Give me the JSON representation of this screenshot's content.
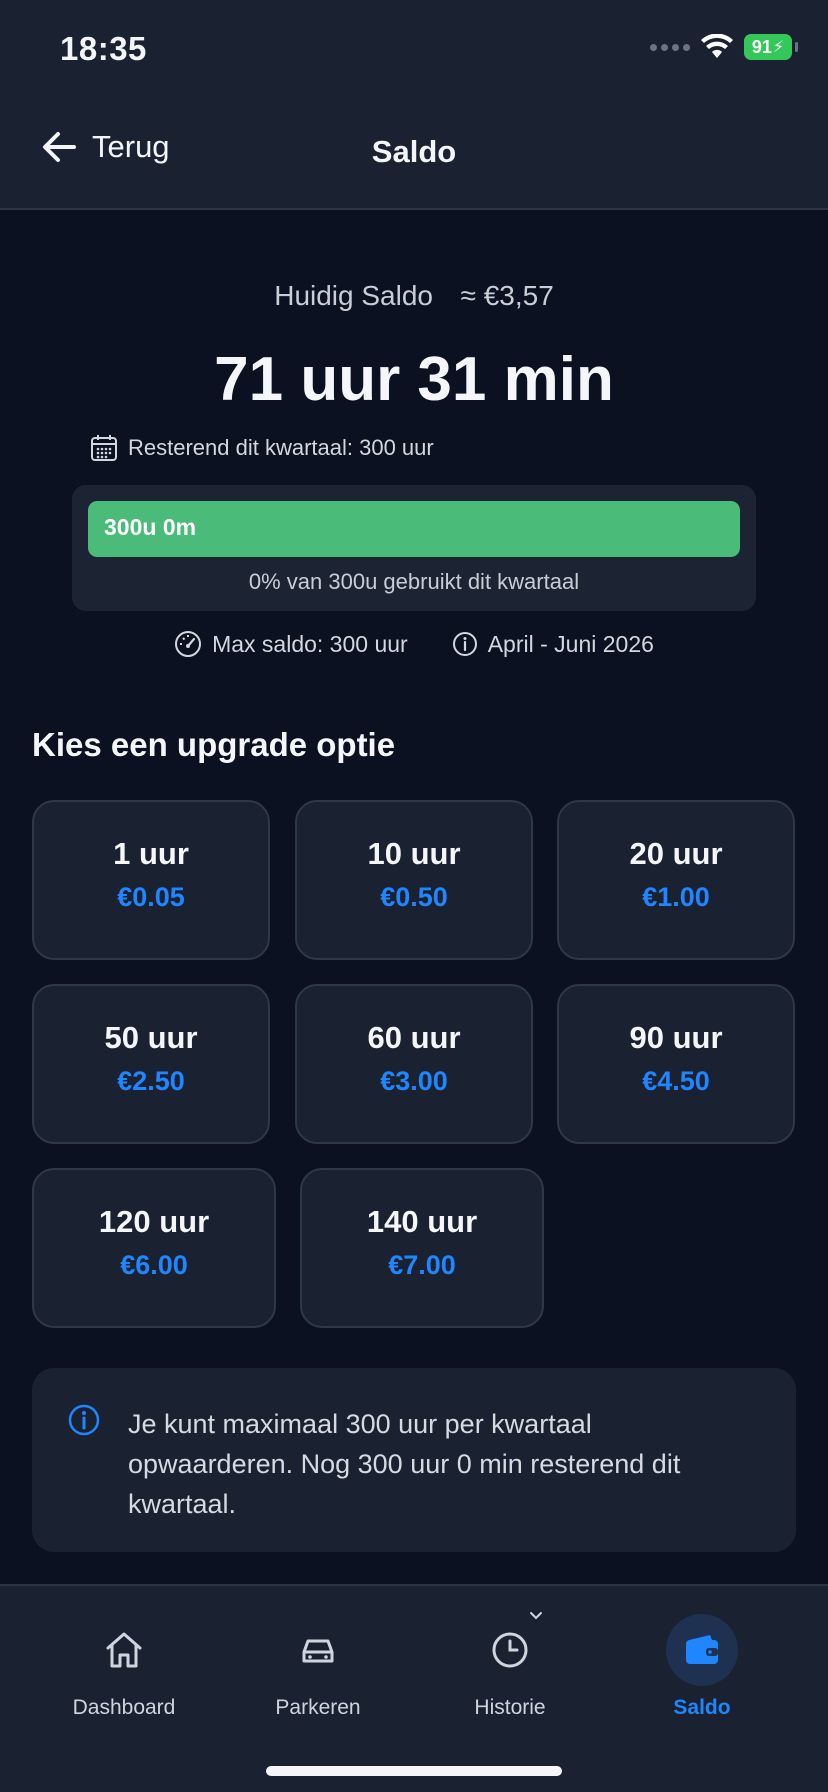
{
  "status_bar": {
    "time": "18:35",
    "battery": "91"
  },
  "header": {
    "back_label": "Terug",
    "title": "Saldo"
  },
  "balance": {
    "label": "Huidig Saldo",
    "approx_amount": "≈ €3,57",
    "time_left": "71 uur 31 min",
    "remaining_quarter": "Resterend dit kwartaal: 300 uur"
  },
  "quarter_progress": {
    "bar_text": "300u 0m",
    "remaining_fraction": 1.0,
    "caption": "0% van 300u gebruikt dit kwartaal"
  },
  "meta": {
    "max_balance": "Max saldo: 300 uur",
    "period": "April - Juni 2026"
  },
  "upgrade": {
    "title": "Kies een upgrade optie",
    "options": [
      {
        "hours": "1 uur",
        "price": "€0.05"
      },
      {
        "hours": "10 uur",
        "price": "€0.50"
      },
      {
        "hours": "20 uur",
        "price": "€1.00"
      },
      {
        "hours": "50 uur",
        "price": "€2.50"
      },
      {
        "hours": "60 uur",
        "price": "€3.00"
      },
      {
        "hours": "90 uur",
        "price": "€4.50"
      },
      {
        "hours": "120 uur",
        "price": "€6.00"
      },
      {
        "hours": "140 uur",
        "price": "€7.00"
      }
    ]
  },
  "info": {
    "text": "Je kunt maximaal 300 uur per kwartaal opwaarderen. Nog 300 uur 0 min resterend dit kwartaal."
  },
  "tabs": [
    {
      "label": "Dashboard",
      "icon": "home-icon",
      "active": false
    },
    {
      "label": "Parkeren",
      "icon": "car-icon",
      "active": false
    },
    {
      "label": "Historie",
      "icon": "clock-icon",
      "active": false
    },
    {
      "label": "Saldo",
      "icon": "wallet-icon",
      "active": true
    }
  ],
  "colors": {
    "background": "#0b1120",
    "surface": "#1a2232",
    "accent": "#1f86ff",
    "progress_green": "#4bbb7a"
  }
}
